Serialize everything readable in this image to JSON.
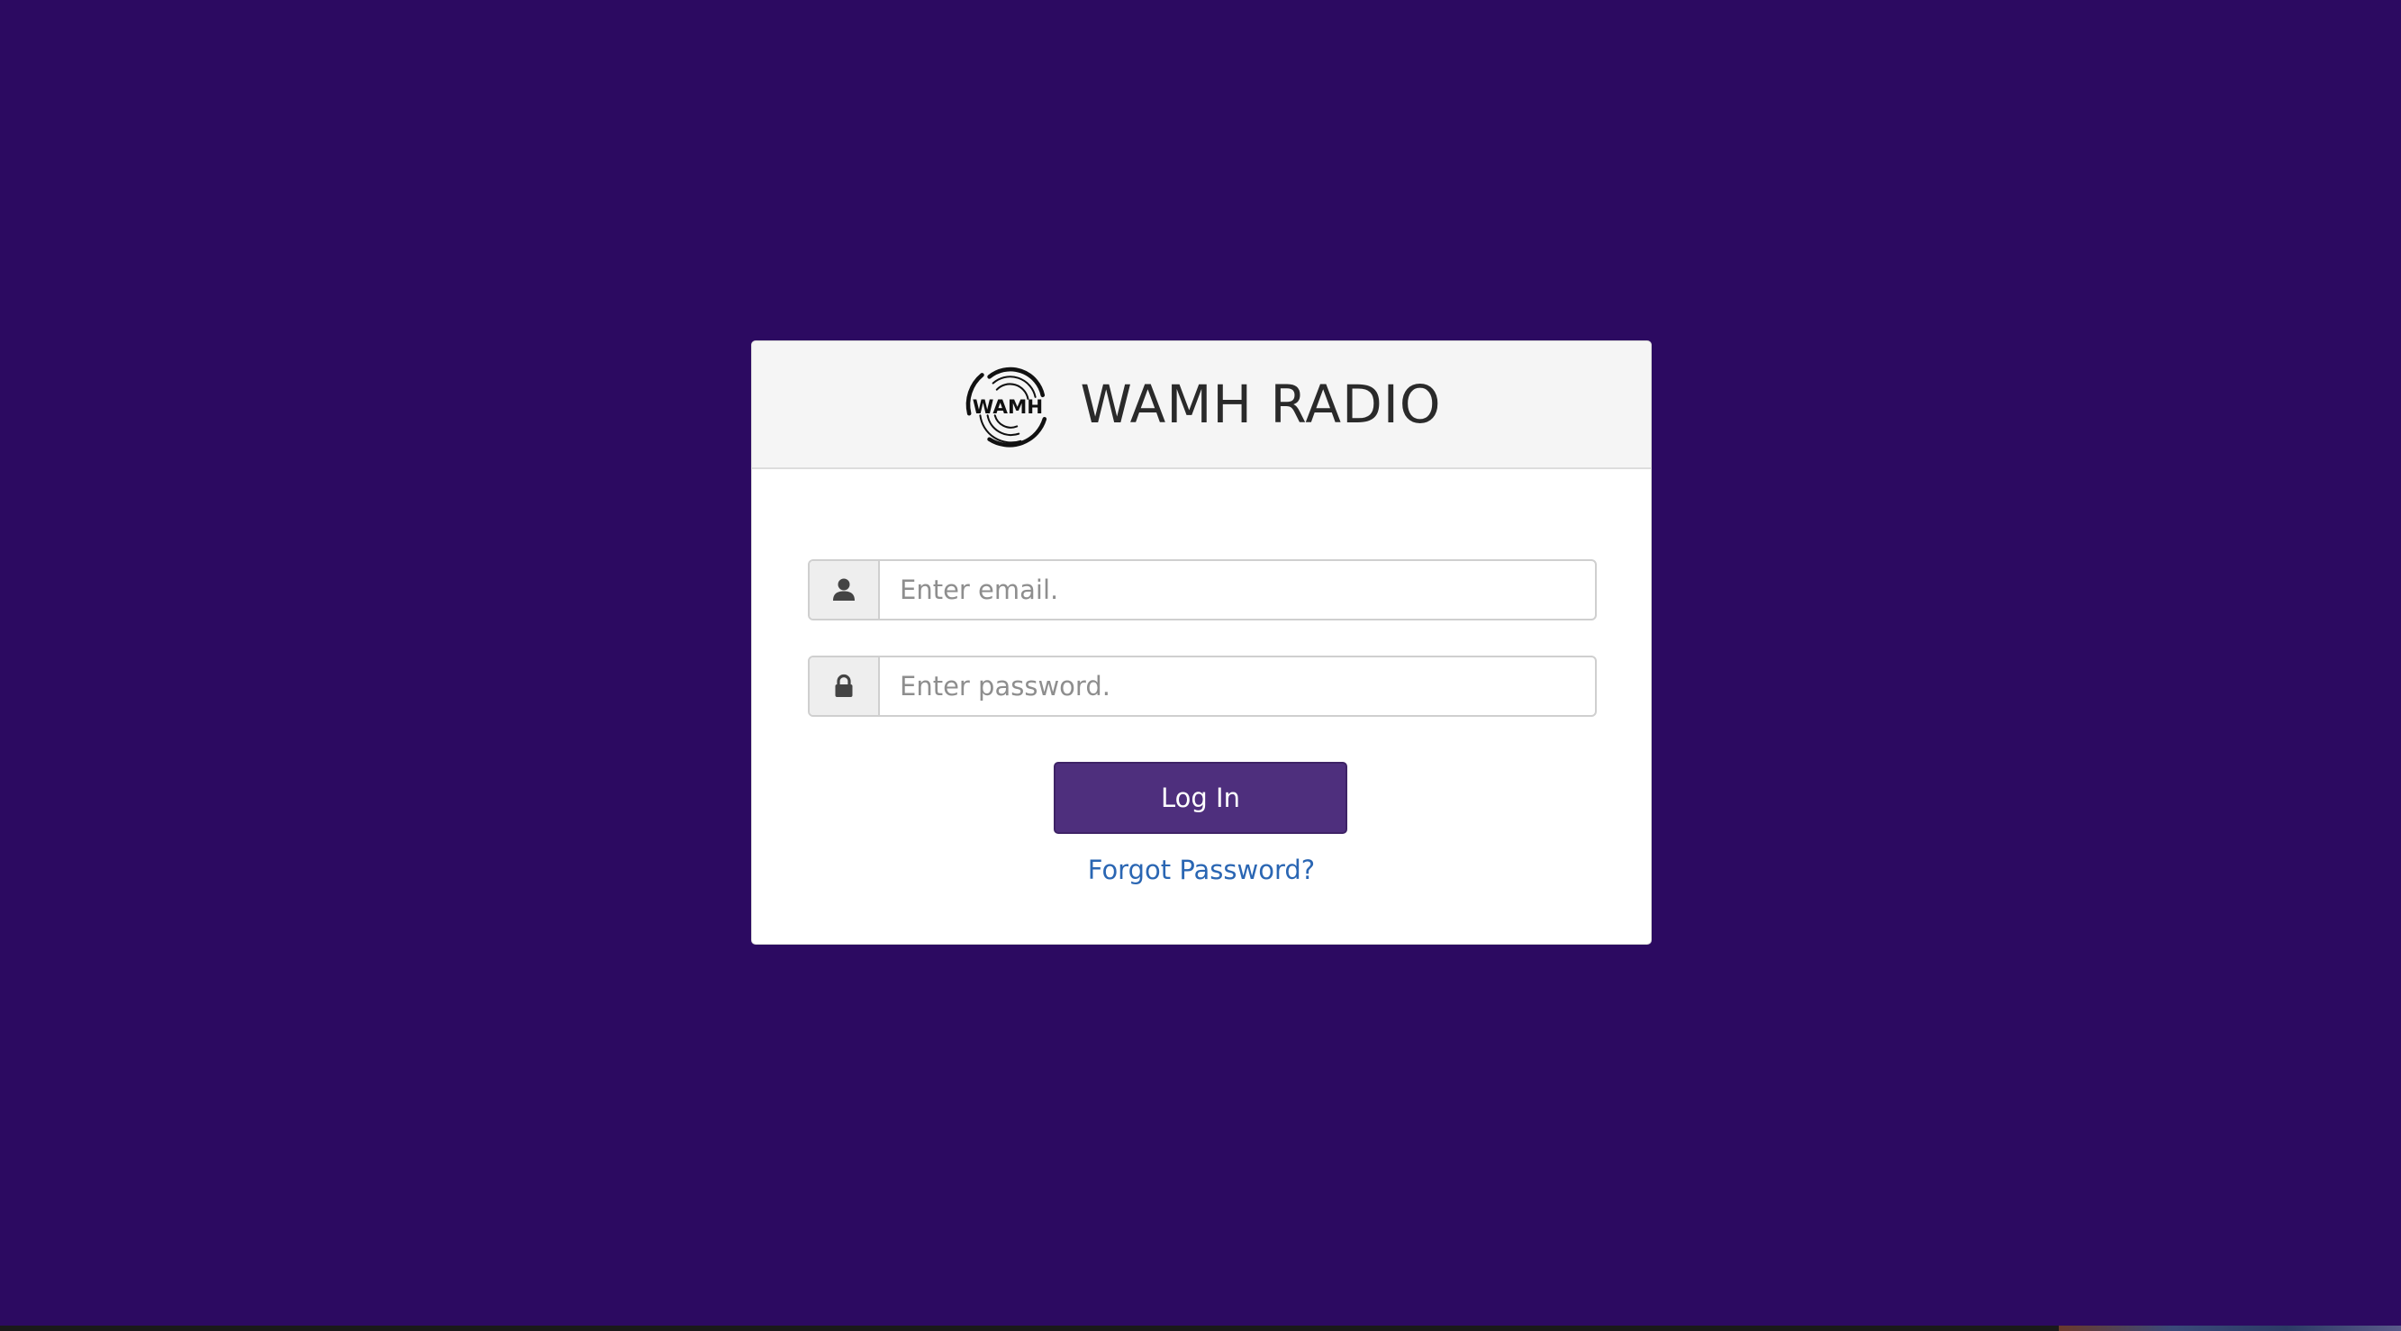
{
  "header": {
    "title": "WAMH RADIO",
    "logo_icon": "wamh-record-logo",
    "logo_text": "WAMH"
  },
  "form": {
    "email_placeholder": "Enter email.",
    "email_value": "",
    "email_icon": "user-icon",
    "password_placeholder": "Enter password.",
    "password_value": "",
    "password_icon": "lock-icon",
    "login_label": "Log In",
    "forgot_label": "Forgot Password?"
  },
  "colors": {
    "background": "#2c0a61",
    "button": "#4e2f7d",
    "link": "#2a66b3",
    "header_bg": "#f5f5f5"
  }
}
